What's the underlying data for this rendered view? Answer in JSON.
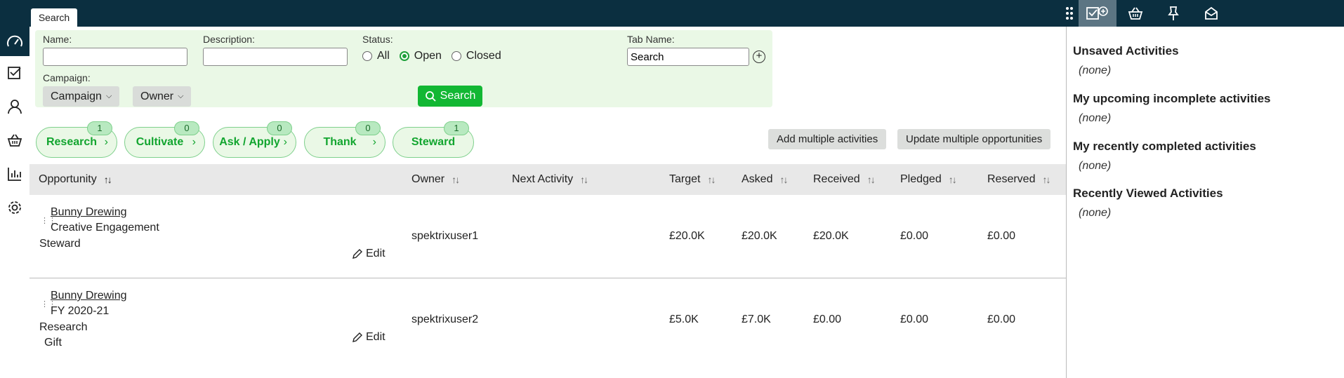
{
  "top_tab": "Search",
  "search": {
    "name_label": "Name:",
    "description_label": "Description:",
    "status_label": "Status:",
    "status_options": [
      "All",
      "Open",
      "Closed"
    ],
    "tab_name_label": "Tab Name:",
    "tab_name_value": "Search",
    "campaign_label": "Campaign:",
    "campaign_button": "Campaign",
    "owner_button": "Owner",
    "search_button": "Search"
  },
  "stages": [
    {
      "label": "Research",
      "count": "1"
    },
    {
      "label": "Cultivate",
      "count": "0"
    },
    {
      "label": "Ask / Apply",
      "count": "0"
    },
    {
      "label": "Thank",
      "count": "0"
    },
    {
      "label": "Steward",
      "count": "1"
    }
  ],
  "actions": {
    "add_multiple": "Add multiple activities",
    "update_multiple": "Update multiple opportunities"
  },
  "table": {
    "columns": [
      "Opportunity",
      "Owner",
      "Next Activity",
      "Target",
      "Asked",
      "Received",
      "Pledged",
      "Reserved"
    ],
    "rows": [
      {
        "name": "Bunny Drewing",
        "line2": "Creative Engagement",
        "line3": "Steward",
        "line4": "",
        "edit": "Edit",
        "owner": "spektrixuser1",
        "next": "",
        "target": "£20.0K",
        "asked": "£20.0K",
        "received": "£20.0K",
        "pledged": "£0.00",
        "reserved": "£0.00"
      },
      {
        "name": "Bunny Drewing",
        "line2": "FY 2020-21",
        "line3": "Research",
        "line4": "Gift",
        "edit": "Edit",
        "owner": "spektrixuser2",
        "next": "",
        "target": "£5.0K",
        "asked": "£7.0K",
        "received": "£0.00",
        "pledged": "£0.00",
        "reserved": "£0.00"
      }
    ]
  },
  "right_panel": {
    "sections": [
      {
        "title": "Unsaved Activities",
        "value": "(none)"
      },
      {
        "title": "My upcoming incomplete activities",
        "value": "(none)"
      },
      {
        "title": "My recently completed activities",
        "value": "(none)"
      },
      {
        "title": "Recently Viewed Activities",
        "value": "(none)"
      }
    ]
  },
  "colors": {
    "topbar": "#0b2f40",
    "accent_green": "#12b733",
    "panel_bg": "#eaf8e6"
  }
}
